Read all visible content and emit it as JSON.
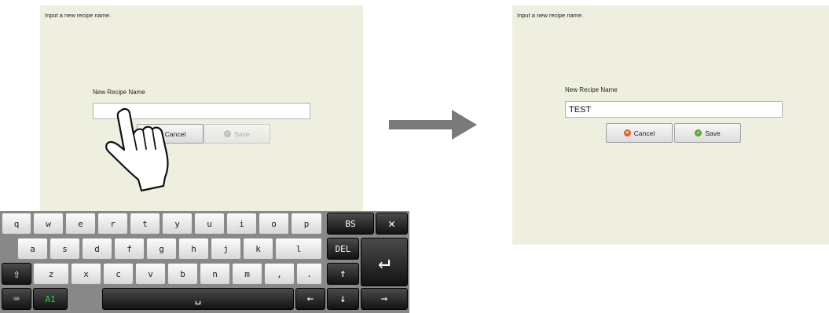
{
  "left": {
    "instruction": "Input a new recipe name.",
    "field_label": "New Recipe Name",
    "field_value": "",
    "cancel_label": "Cancel",
    "save_label": "Save"
  },
  "right": {
    "instruction": "Input a new recipe name.",
    "field_label": "New Recipe Name",
    "field_value": "TEST",
    "cancel_label": "Cancel",
    "save_label": "Save"
  },
  "keyboard": {
    "row1": [
      "q",
      "w",
      "e",
      "r",
      "t",
      "y",
      "u",
      "i",
      "o",
      "p"
    ],
    "row2": [
      "a",
      "s",
      "d",
      "f",
      "g",
      "h",
      "j",
      "k",
      "l"
    ],
    "row3": [
      "z",
      "x",
      "c",
      "v",
      "b",
      "n",
      "m",
      ",",
      "."
    ],
    "backspace": "BS",
    "delete": "DEL",
    "mode": "A1",
    "space": "␣",
    "close": "✕",
    "enter": "↵",
    "shift": "⇧",
    "up": "↑",
    "down": "↓",
    "left": "←",
    "right": "→",
    "keyboard_toggle": "⌨"
  },
  "colors": {
    "panel_bg": "#efefe0",
    "cancel_icon": "#e05a2a",
    "save_icon": "#5ea82f",
    "mode_text": "#2ed23a"
  }
}
